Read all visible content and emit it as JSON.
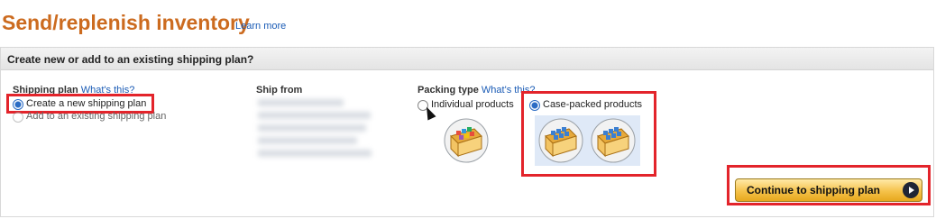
{
  "header": {
    "title": "Send/replenish inventory",
    "learn_more": "Learn more"
  },
  "panel": {
    "heading": "Create new or add to an existing shipping plan?"
  },
  "shipping_plan": {
    "label": "Shipping plan",
    "help_link": "What's this?",
    "options": [
      {
        "label": "Create a new shipping plan",
        "selected": true
      },
      {
        "label": "Add to an existing shipping plan",
        "selected": false
      }
    ]
  },
  "ship_from": {
    "label": "Ship from"
  },
  "packing_type": {
    "label": "Packing type",
    "help_link": "What's this?",
    "options": [
      {
        "label": "Individual products",
        "selected": false
      },
      {
        "label": "Case-packed products",
        "selected": true
      }
    ]
  },
  "actions": {
    "continue_label": "Continue to shipping plan"
  },
  "colors": {
    "title": "#cc6b1f",
    "link": "#1a5bb5",
    "highlight": "#e3242b",
    "button": "#f5c24a"
  }
}
